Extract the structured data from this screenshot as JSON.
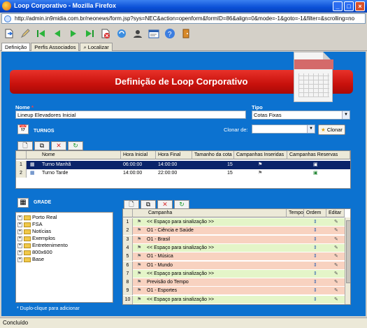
{
  "window": {
    "title": "Loop Corporativo - Mozilla Firefox",
    "url": "http://admin.in9midia.com.br/neonews/form.jsp?sys=NEC&action=openform&formID=86&align=0&mode=-1&goto=-1&filter=&scrolling=no"
  },
  "toolbar": {
    "icons": [
      "new-icon",
      "edit-icon",
      "first-icon",
      "previous-icon",
      "next-icon",
      "last-icon",
      "delete-icon",
      "refresh-icon",
      "user-icon",
      "form-icon",
      "help-icon",
      "exit-icon"
    ]
  },
  "tabs": [
    {
      "label": "Definição"
    },
    {
      "label": "Perfis Associados"
    },
    {
      "label": "Localizar"
    }
  ],
  "header": {
    "title": "Definição de Loop Corporativo"
  },
  "form": {
    "nome_label": "Nome",
    "nome_required": "*",
    "nome_value": "Lineup Elevadores Inicial",
    "tipo_label": "Tipo",
    "tipo_value": "Cotas Fixas",
    "clonar_label": "Clonar de:",
    "clonar_value": "",
    "clonar_button": "Clonar"
  },
  "turnos": {
    "section_label": "TURNOS",
    "columns": [
      "Nome",
      "Hora Inicial",
      "Hora Final",
      "Tamanho da cota",
      "Campanhas Inseridas",
      "Campanhas Reservas"
    ],
    "rows": [
      {
        "num": "1",
        "nome": "Turno Manhã",
        "inicio": "06:00:00",
        "fim": "14:00:00",
        "cota": "15"
      },
      {
        "num": "2",
        "nome": "Turno Tarde",
        "inicio": "14:00:00",
        "fim": "22:00:00",
        "cota": "15"
      }
    ]
  },
  "grade": {
    "section_label": "GRADE",
    "tree": [
      "Porto Real",
      "FSA",
      "Notícias",
      "Exemplos",
      "Entretenimento",
      "800x600",
      "Base"
    ],
    "hint": "* Duplo-clique para adicionar",
    "columns": [
      "Campanha",
      "Tempo",
      "Ordem",
      "Editar"
    ],
    "rows": [
      {
        "num": "1",
        "campanha": "<< Espaço para sinalização >>",
        "color": "#e4f5c8"
      },
      {
        "num": "2",
        "campanha": "O1 - Ciência e Saúde",
        "color": "#f8d2c0"
      },
      {
        "num": "3",
        "campanha": "O1 - Brasil",
        "color": "#f8d2c0"
      },
      {
        "num": "4",
        "campanha": "<< Espaço para sinalização >>",
        "color": "#e4f5c8"
      },
      {
        "num": "5",
        "campanha": "O1 - Música",
        "color": "#f8d2c0"
      },
      {
        "num": "6",
        "campanha": "O1 - Mundo",
        "color": "#f8d2c0"
      },
      {
        "num": "7",
        "campanha": "<< Espaço para sinalização >>",
        "color": "#e4f5c8"
      },
      {
        "num": "8",
        "campanha": "Previsão do Tempo",
        "color": "#f8d2c0"
      },
      {
        "num": "9",
        "campanha": "O1 - Esportes",
        "color": "#f8d2c0"
      },
      {
        "num": "10",
        "campanha": "<< Espaço para sinalização >>",
        "color": "#e4f5c8"
      }
    ]
  },
  "status": {
    "text": "Concluído"
  },
  "colors": {
    "accent": "#0c72d0",
    "header": "#c8110c",
    "selected_row": "#0a246a"
  }
}
